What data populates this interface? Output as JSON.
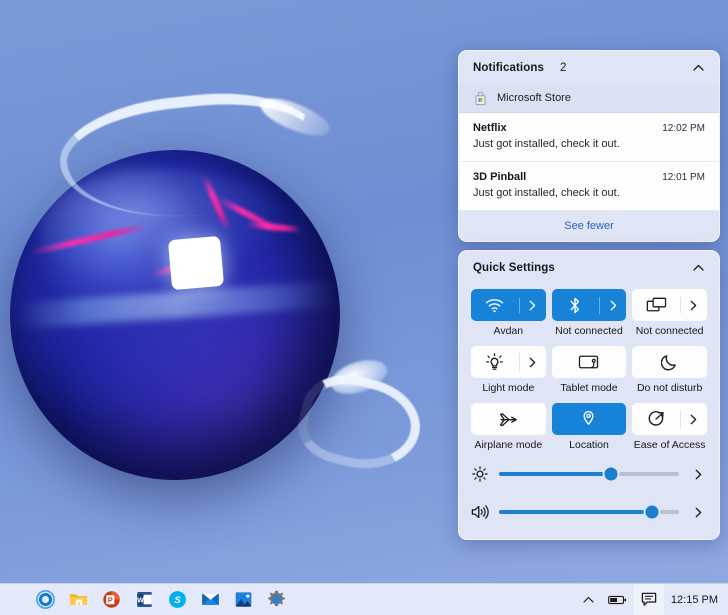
{
  "notifications": {
    "title": "Notifications",
    "count": "2",
    "collapse_icon": "chevron-up-icon",
    "group": {
      "name": "Microsoft Store",
      "icon": "microsoft-store-icon"
    },
    "items": [
      {
        "app": "Netflix",
        "time": "12:02 PM",
        "body": "Just got installed, check it out."
      },
      {
        "app": "3D Pinball",
        "time": "12:01 PM",
        "body": "Just got installed, check it out."
      }
    ],
    "see_fewer_label": "See fewer"
  },
  "quick_settings": {
    "title": "Quick Settings",
    "collapse_icon": "chevron-up-icon",
    "tiles": [
      {
        "label": "Avdan",
        "icon": "wifi-icon",
        "active": true,
        "chevron": true
      },
      {
        "label": "Not connected",
        "icon": "bluetooth-icon",
        "active": true,
        "chevron": true
      },
      {
        "label": "Not connected",
        "icon": "cast-icon",
        "active": false,
        "chevron": true
      },
      {
        "label": "Light mode",
        "icon": "lightbulb-icon",
        "active": false,
        "chevron": true
      },
      {
        "label": "Tablet mode",
        "icon": "tablet-icon",
        "active": false,
        "chevron": false
      },
      {
        "label": "Do not disturb",
        "icon": "moon-icon",
        "active": false,
        "chevron": false
      },
      {
        "label": "Airplane mode",
        "icon": "airplane-icon",
        "active": false,
        "chevron": false
      },
      {
        "label": "Location",
        "icon": "location-pin-icon",
        "active": true,
        "chevron": false
      },
      {
        "label": "Ease of Access",
        "icon": "ease-of-access-icon",
        "active": false,
        "chevron": true
      }
    ],
    "sliders": [
      {
        "name": "brightness",
        "icon": "brightness-icon",
        "value": 62,
        "chevron_icon": "chevron-right-icon"
      },
      {
        "name": "volume",
        "icon": "volume-icon",
        "value": 85,
        "chevron_icon": "chevron-right-icon"
      }
    ]
  },
  "taskbar": {
    "apps": [
      {
        "name": "cortana-icon",
        "label": "Cortana"
      },
      {
        "name": "file-explorer-icon",
        "label": "File Explorer"
      },
      {
        "name": "powerpoint-icon",
        "label": "PowerPoint"
      },
      {
        "name": "word-icon",
        "label": "Word"
      },
      {
        "name": "skype-icon",
        "label": "Skype"
      },
      {
        "name": "mail-icon",
        "label": "Mail"
      },
      {
        "name": "photos-icon",
        "label": "Photos"
      },
      {
        "name": "settings-icon",
        "label": "Settings"
      }
    ],
    "tray": {
      "overflow_icon": "chevron-up-icon",
      "battery_icon": "battery-icon",
      "chat_icon": "chat-bubble-icon",
      "clock": "12:15 PM"
    }
  },
  "colors": {
    "accent": "#1683d8",
    "panel_bg": "#dfe5f5",
    "card_bg": "#fdfdfe",
    "taskbar_bg": "#e3e9f8",
    "link": "#2a62b8",
    "desktop_blue": "#6e8ed3"
  }
}
